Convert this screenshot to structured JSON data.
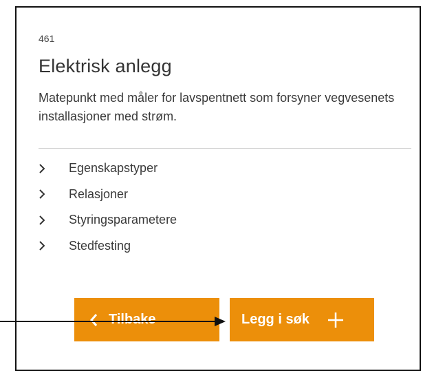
{
  "object": {
    "id": "461",
    "title": "Elektrisk anlegg",
    "description": "Matepunkt med måler for lavspentnett som forsyner vegvesenets installasjoner med strøm."
  },
  "sections": [
    {
      "label": "Egenskapstyper",
      "icon": "chevron-right-icon"
    },
    {
      "label": "Relasjoner",
      "icon": "chevron-right-icon"
    },
    {
      "label": "Styringsparametere",
      "icon": "chevron-right-icon"
    },
    {
      "label": "Stedfesting",
      "icon": "chevron-right-icon"
    }
  ],
  "buttons": {
    "back_label": "Tilbake",
    "back_icon": "chevron-left-icon",
    "add_label": "Legg i søk",
    "add_icon": "plus-icon"
  },
  "colors": {
    "accent": "#ec8f0a",
    "text": "#333333",
    "divider": "#d0d0d0",
    "annotation_arrow": "#111111"
  }
}
